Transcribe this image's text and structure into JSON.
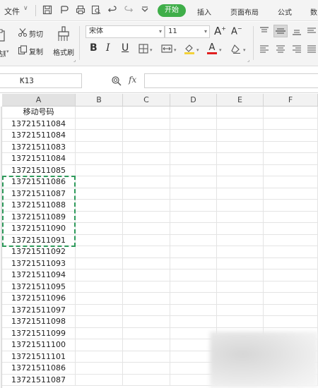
{
  "menu": {
    "file_label": "文件",
    "file_arrow": "∨",
    "tabs": [
      "开始",
      "插入",
      "页面布局",
      "公式",
      "数"
    ]
  },
  "ribbon": {
    "cut_label": "剪切",
    "copy_label": "复制",
    "format_painter_label": "格式刷",
    "paste_label": "粘贴",
    "font_name": "宋体",
    "font_size": "11",
    "bold": "B",
    "italic": "I",
    "underline": "U",
    "grow_font": "A⁺",
    "shrink_font": "A⁻"
  },
  "formula_bar": {
    "name_box": "K13",
    "fx_label": "fx",
    "formula_value": ""
  },
  "sheet": {
    "columns": [
      "A",
      "B",
      "C",
      "D",
      "E",
      "F"
    ],
    "selected_column": "A",
    "header_cell": "移动号码",
    "column_a_values": [
      "13721511084",
      "13721511084",
      "13721511083",
      "13721511084",
      "13721511085",
      "13721511086",
      "13721511087",
      "13721511088",
      "13721511089",
      "13721511090",
      "13721511091",
      "13721511092",
      "13721511093",
      "13721511094",
      "13721511095",
      "13721511096",
      "13721511097",
      "13721511098",
      "13721511099",
      "13721511100",
      "13721511101",
      "13721511086",
      "13721511087"
    ],
    "copy_range_rows": [
      6,
      11
    ]
  },
  "colors": {
    "accent_green": "#3fae49",
    "marquee_green": "#2e9a5b",
    "font_color_red": "#e02020",
    "highlight_yellow": "#f3d23a"
  }
}
